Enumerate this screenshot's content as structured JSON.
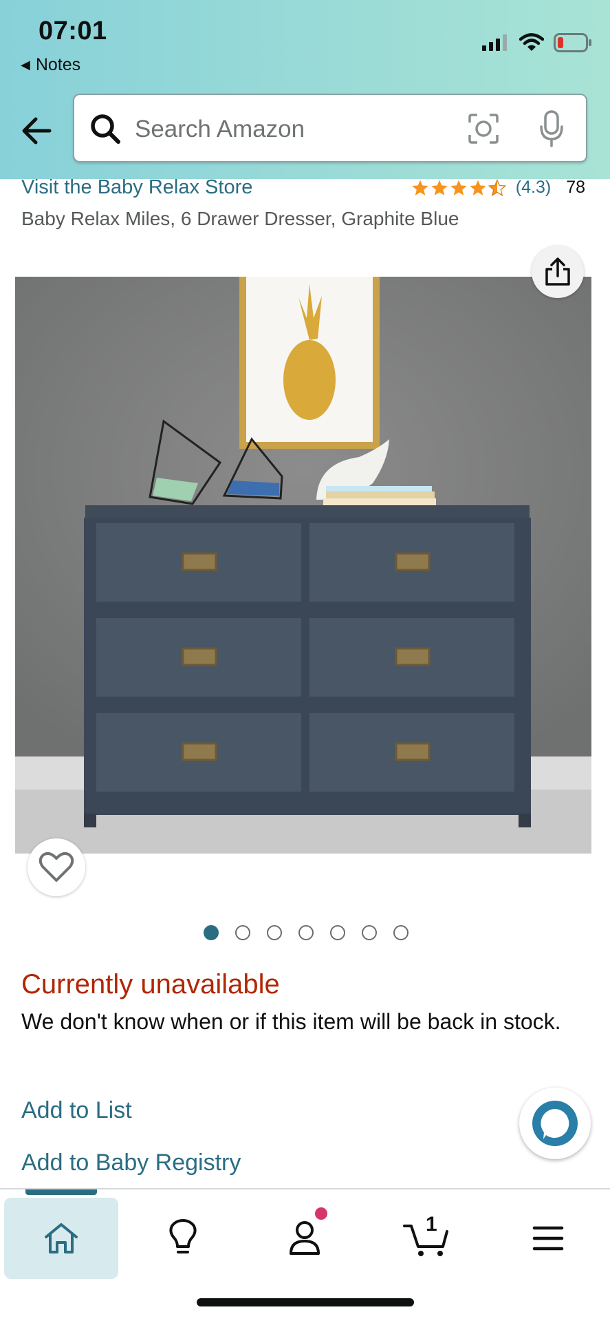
{
  "status_bar": {
    "time": "07:01",
    "back_app_label": "Notes",
    "icons": [
      "signal-icon",
      "wifi-icon",
      "battery-low-icon"
    ]
  },
  "search": {
    "placeholder": "Search Amazon",
    "icons": [
      "back-arrow-icon",
      "search-icon",
      "camera-lens-icon",
      "microphone-icon"
    ]
  },
  "product": {
    "store_link": "Visit the Baby Relax Store",
    "rating_value": 4.3,
    "rating_text": "(4.3)",
    "review_count": "78",
    "title": "Baby Relax Miles, 6 Drawer Dresser, Graphite Blue",
    "image_count": 7,
    "active_image_index": 0
  },
  "availability": {
    "heading": "Currently unavailable",
    "note": "We don't know when or if this item will be back in stock."
  },
  "actions": {
    "add_to_list": "Add to List",
    "add_to_registry": "Add to Baby Registry"
  },
  "bottom_nav": {
    "items": [
      {
        "name": "home",
        "icon": "home-icon",
        "active": true
      },
      {
        "name": "inspire",
        "icon": "lightbulb-icon",
        "active": false
      },
      {
        "name": "account",
        "icon": "person-icon",
        "active": false
      },
      {
        "name": "cart",
        "icon": "cart-icon",
        "active": false
      },
      {
        "name": "menu",
        "icon": "menu-icon",
        "active": false
      }
    ],
    "cart_count": "1"
  },
  "colors": {
    "link": "#2a6d83",
    "unavailable": "#b12704",
    "star": "#f7941d",
    "account_badge": "#d6356a",
    "header_gradient_start": "#88d1d9",
    "header_gradient_end": "#a8e3d5"
  }
}
